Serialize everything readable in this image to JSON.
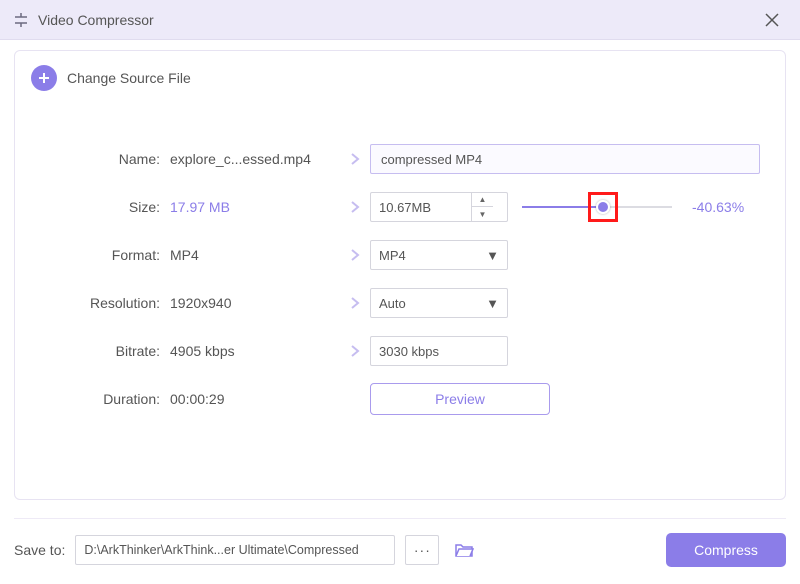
{
  "titlebar": {
    "title": "Video Compressor"
  },
  "change_source": {
    "label": "Change Source File"
  },
  "fields": {
    "name": {
      "label": "Name:",
      "value": "explore_c...essed.mp4",
      "input": "compressed MP4"
    },
    "size": {
      "label": "Size:",
      "value": "17.97 MB",
      "input": "10.67MB",
      "percent": "-40.63%",
      "slider_pct": 54
    },
    "format": {
      "label": "Format:",
      "value": "MP4",
      "input": "MP4"
    },
    "resolution": {
      "label": "Resolution:",
      "value": "1920x940",
      "input": "Auto"
    },
    "bitrate": {
      "label": "Bitrate:",
      "value": "4905 kbps",
      "input": "3030 kbps"
    },
    "duration": {
      "label": "Duration:",
      "value": "00:00:29"
    }
  },
  "buttons": {
    "preview": "Preview",
    "compress": "Compress"
  },
  "save": {
    "label": "Save to:",
    "path": "D:\\ArkThinker\\ArkThink...er Ultimate\\Compressed"
  }
}
